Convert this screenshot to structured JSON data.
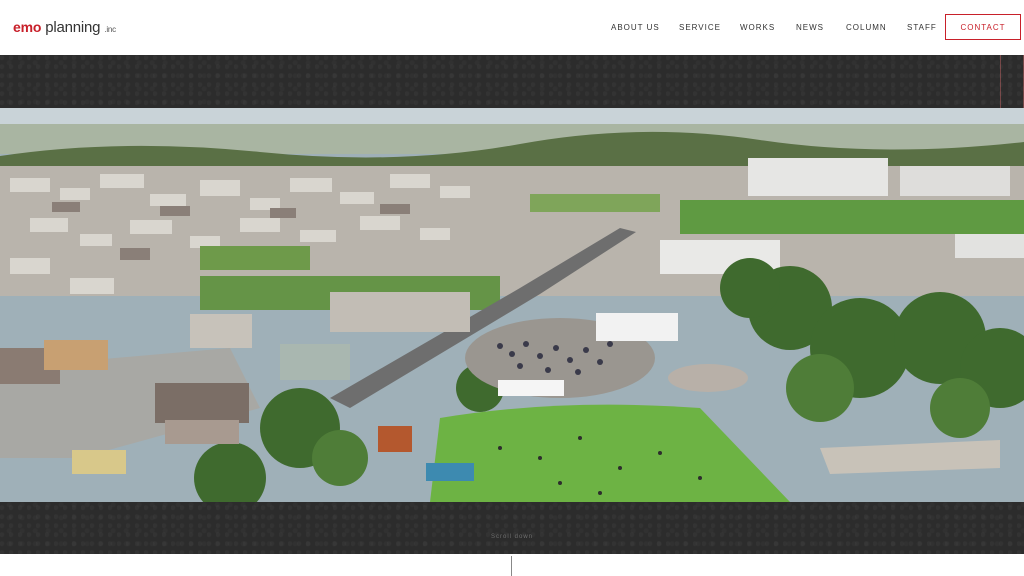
{
  "brand": {
    "emo": "emo",
    "planning": "planning",
    "inc": ".inc",
    "accent": "#c8202a"
  },
  "nav": {
    "items": [
      {
        "label": "ABOUT US"
      },
      {
        "label": "SERVICE"
      },
      {
        "label": "WORKS"
      },
      {
        "label": "NEWS"
      },
      {
        "label": "COLUMN"
      },
      {
        "label": "STAFF"
      }
    ],
    "contact": "CONTACT"
  },
  "hero": {
    "scroll_label": "Scroll down",
    "image_icon": "aerial-park-festival-photo"
  }
}
